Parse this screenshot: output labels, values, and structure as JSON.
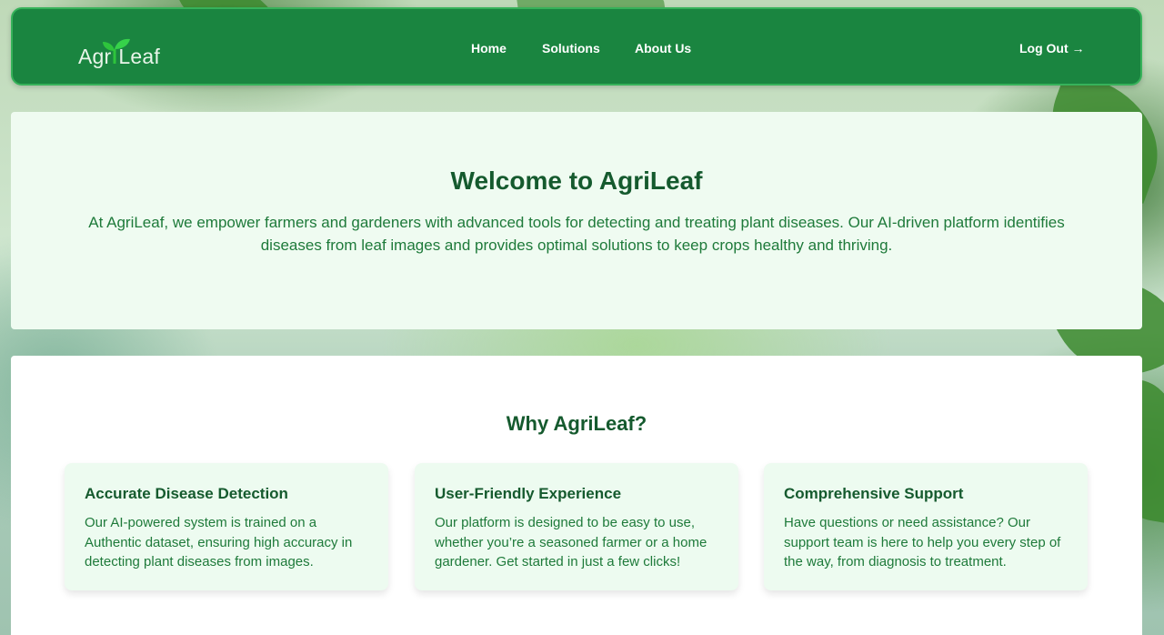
{
  "nav": {
    "logo_left": "Agr",
    "logo_right": "Leaf",
    "links": [
      {
        "label": "Home"
      },
      {
        "label": "Solutions"
      },
      {
        "label": "About Us"
      }
    ],
    "logout_label": "Log Out →"
  },
  "hero": {
    "title": "Welcome to AgriLeaf",
    "description": "At AgriLeaf, we empower farmers and gardeners with advanced tools for detecting and treating plant diseases. Our AI-driven platform identifies diseases from leaf images and provides optimal solutions to keep crops healthy and thriving."
  },
  "why": {
    "title": "Why AgriLeaf?",
    "cards": [
      {
        "title": "Accurate Disease Detection",
        "text": "Our AI-powered system is trained on a Authentic dataset, ensuring high accuracy in detecting plant diseases from images."
      },
      {
        "title": "User-Friendly Experience",
        "text": "Our platform is designed to be easy to use, whether you’re a seasoned farmer or a home gardener. Get started in just a few clicks!"
      },
      {
        "title": "Comprehensive Support",
        "text": "Have questions or need assistance? Our support team is here to help you every step of the way, from diagnosis to treatment."
      }
    ]
  },
  "colors": {
    "navbar": "#1a8540",
    "heading": "#155a2e",
    "body_text": "#1e7a3a",
    "hero_bg": "#effbf1",
    "card_bg": "#edfbf0"
  },
  "icons": {
    "logo": "sprout-icon"
  }
}
